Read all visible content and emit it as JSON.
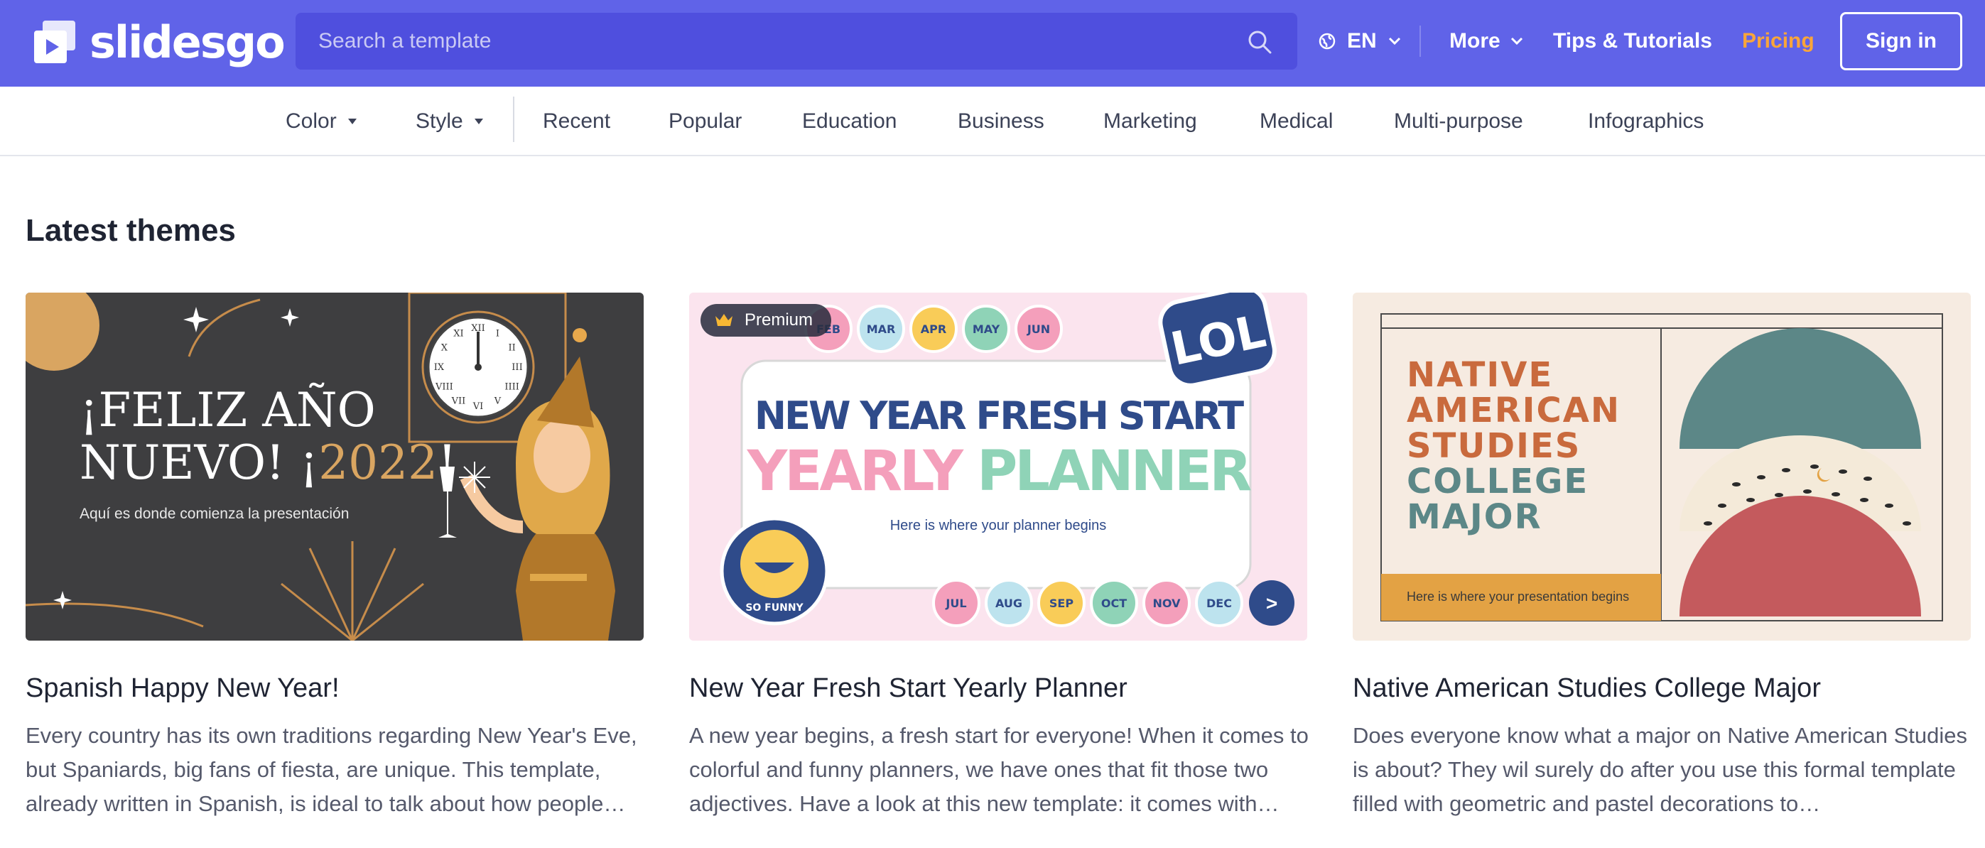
{
  "header": {
    "logo_text": "slidesgo",
    "search_placeholder": "Search a template",
    "language": "EN",
    "more_label": "More",
    "tips_label": "Tips & Tutorials",
    "pricing_label": "Pricing",
    "signin_label": "Sign in",
    "colors": {
      "bar": "#6063e8",
      "search": "#4f4fde",
      "pricing": "#f9a53a"
    }
  },
  "categories": {
    "color_label": "Color",
    "style_label": "Style",
    "items": [
      "Recent",
      "Popular",
      "Education",
      "Business",
      "Marketing",
      "Medical",
      "Multi-purpose",
      "Infographics"
    ]
  },
  "main": {
    "section_title": "Latest themes",
    "cards": [
      {
        "title": "Spanish Happy New Year!",
        "description": "Every country has its own traditions regarding New Year's Eve, but Spaniards, big fans of fiesta, are unique. This template, already written in Spanish, is ideal to talk about how people…",
        "premium": false,
        "thumb": {
          "line1": "¡FELIZ AÑO",
          "line2": "NUEVO! ¡",
          "year": "2022",
          "exclaim": "!",
          "subtitle": "Aquí es donde comienza la presentación",
          "clock_numerals": [
            "XII",
            "I",
            "II",
            "III",
            "IIII",
            "V",
            "VI",
            "VII",
            "VIII",
            "IX",
            "X",
            "XI"
          ]
        }
      },
      {
        "title": "New Year Fresh Start Yearly Planner",
        "description": "A new year begins, a fresh start for everyone! When it comes to colorful and funny planners, we have ones that fit those two adjectives. Have a look at this new template: it comes with…",
        "premium": true,
        "badge_label": "Premium",
        "thumb": {
          "title_line1": "NEW YEAR FRESH START",
          "title_word_a": "YEARLY",
          "title_word_b": "PLANNER",
          "subtitle": "Here is where your planner begins",
          "top_months": [
            "FEB",
            "MAR",
            "APR",
            "MAY",
            "JUN"
          ],
          "bottom_months": [
            "JUL",
            "AUG",
            "SEP",
            "OCT",
            "NOV",
            "DEC"
          ],
          "next_symbol": ">",
          "sticker_lol": "LOL",
          "sticker_funny": "SO FUNNY"
        }
      },
      {
        "title": "Native American Studies College Major",
        "description": "Does everyone know what a major on Native American Studies is about? They wil surely do after you use this formal template filled with geometric and pastel decorations to…",
        "premium": false,
        "thumb": {
          "line1": "NATIVE",
          "line2": "AMERICAN",
          "line3": "STUDIES",
          "line4": "COLLEGE",
          "line5": "MAJOR",
          "subtitle": "Here is where your presentation begins"
        }
      }
    ]
  }
}
